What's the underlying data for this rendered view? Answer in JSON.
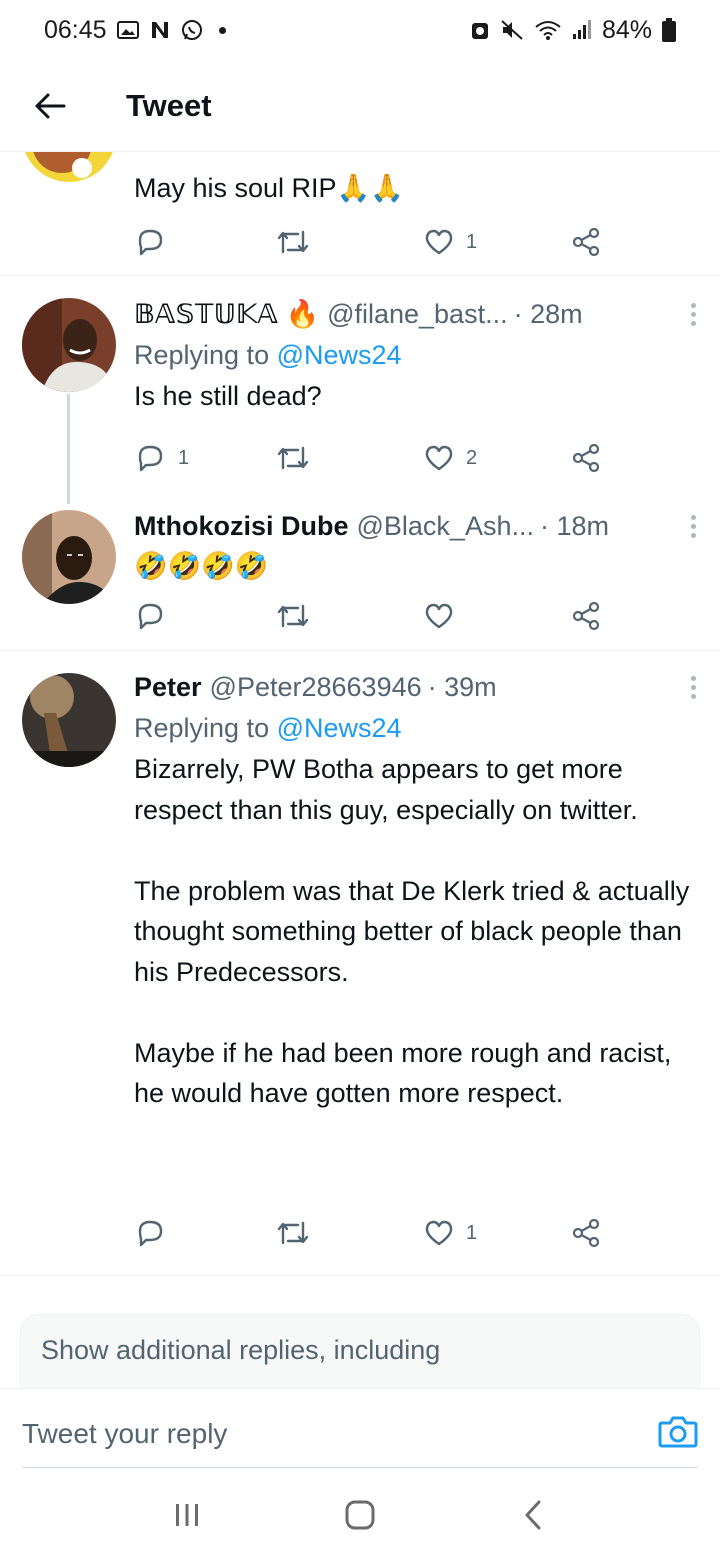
{
  "status_bar": {
    "time": "06:45",
    "battery": "84%",
    "icons_left": [
      "gallery-icon",
      "n-app-icon",
      "whatsapp-icon"
    ],
    "icons_right": [
      "alarm-icon",
      "mute-icon",
      "wifi-icon",
      "signal-icon",
      "battery-icon"
    ]
  },
  "header": {
    "title": "Tweet"
  },
  "tweets": [
    {
      "name": "",
      "handle": "",
      "time": "",
      "replying_prefix": "",
      "replying_mention": "",
      "text": "May his soul RIP🙏🙏",
      "counts": {
        "reply": "",
        "retweet": "",
        "like": "1"
      }
    },
    {
      "name": "𝔹𝔸𝕊𝕋𝕌𝕂𝔸",
      "name_emoji": "🔥",
      "handle": "@filane_bast...",
      "time": "· 28m",
      "replying_prefix": "Replying to ",
      "replying_mention": "@News24",
      "text": "Is he still dead?",
      "counts": {
        "reply": "1",
        "retweet": "",
        "like": "2"
      }
    },
    {
      "name": "Mthokozisi Dube",
      "handle": "@Black_Ash...",
      "time": "· 18m",
      "replying_prefix": "",
      "replying_mention": "",
      "text": "🤣🤣🤣🤣",
      "counts": {
        "reply": "",
        "retweet": "",
        "like": ""
      }
    },
    {
      "name": "Peter",
      "handle": "@Peter28663946",
      "time": "· 39m",
      "replying_prefix": "Replying to ",
      "replying_mention": "@News24",
      "text": "Bizarrely, PW Botha appears to get more respect than this guy, especially on twitter.\n\nThe problem was that De Klerk tried & actually thought something better of black people than his Predecessors.\n\nMaybe if he had been more rough and racist, he would have gotten more respect.",
      "counts": {
        "reply": "",
        "retweet": "",
        "like": "1"
      }
    }
  ],
  "show_more": {
    "text": "Show additional replies, including"
  },
  "composer": {
    "placeholder": "Tweet your reply"
  },
  "colors": {
    "accent": "#1d9bf0",
    "text_primary": "#0f1419",
    "text_secondary": "#536471",
    "divider": "#eff3f4"
  }
}
